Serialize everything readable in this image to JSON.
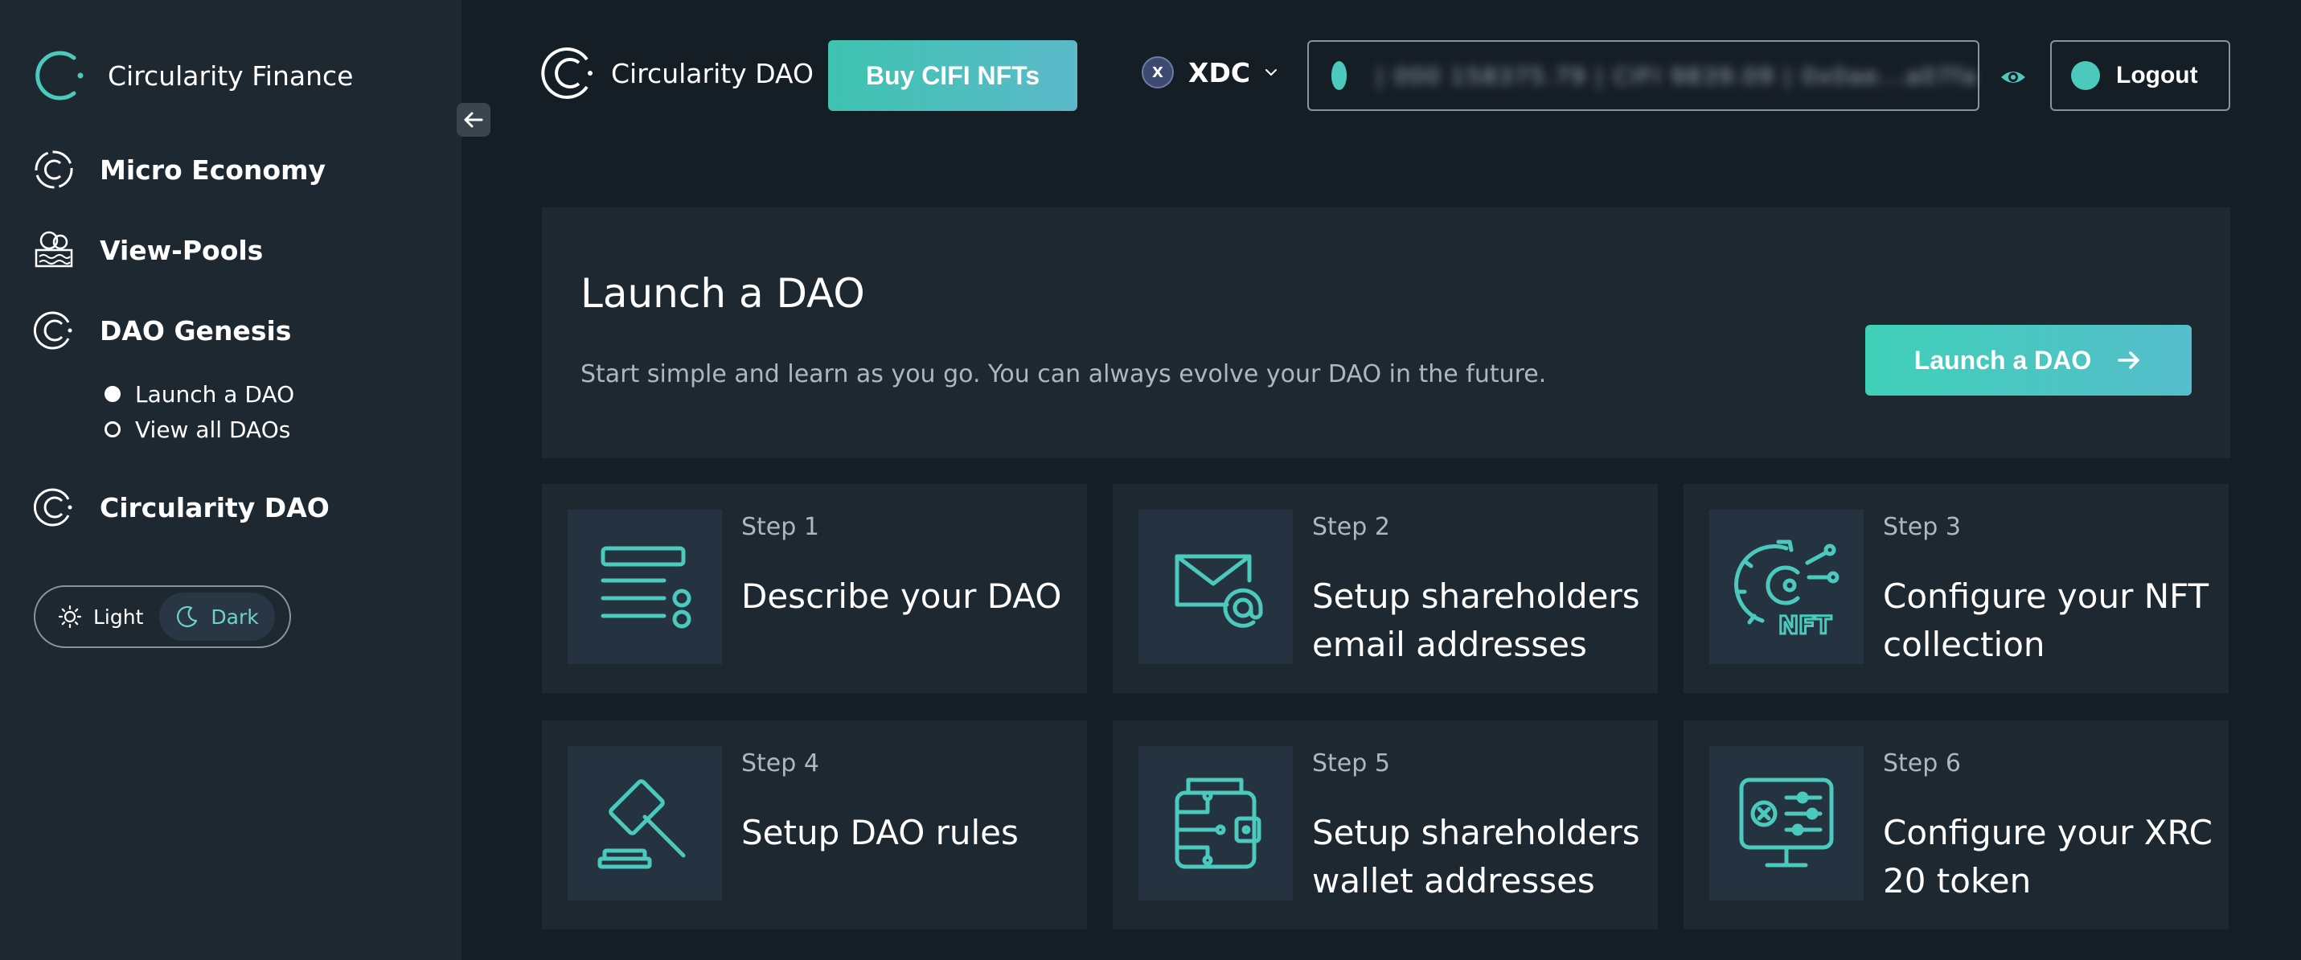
{
  "sidebar": {
    "brand": "Circularity Finance",
    "items": [
      {
        "label": "Micro Economy",
        "icon": "circle-logo-icon"
      },
      {
        "label": "View-Pools",
        "icon": "coins-pool-icon"
      },
      {
        "label": "DAO Genesis",
        "icon": "circle-logo-icon"
      },
      {
        "label": "Circularity DAO",
        "icon": "circle-logo-icon"
      }
    ],
    "subitems": [
      {
        "label": "Launch a DAO",
        "selected": true
      },
      {
        "label": "View all DAOs",
        "selected": false
      }
    ],
    "theme": {
      "light": "Light",
      "dark": "Dark",
      "active": "dark"
    }
  },
  "header": {
    "brand": "Circularity DAO",
    "buy_label": "Buy CIFI NFTs",
    "network": "XDC",
    "network_badge": "X",
    "wallet_text": "| 000 158375.79 | CIFI 9839.09 | 0x0ae...a07fa",
    "logout_label": "Logout"
  },
  "hero": {
    "title": "Launch a DAO",
    "subtitle": "Start simple and learn as you go. You can always evolve your DAO in the future.",
    "button_label": "Launch a DAO"
  },
  "steps": [
    {
      "num": "Step 1",
      "title": "Describe your DAO",
      "icon": "list-icon"
    },
    {
      "num": "Step 2",
      "title": "Setup shareholders email addresses",
      "icon": "envelope-icon"
    },
    {
      "num": "Step 3",
      "title": "Configure your NFT collection",
      "icon": "nft-gear-icon"
    },
    {
      "num": "Step 4",
      "title": "Setup DAO rules",
      "icon": "gavel-icon"
    },
    {
      "num": "Step 5",
      "title": "Setup shareholders wallet addresses",
      "icon": "wallet-icon"
    },
    {
      "num": "Step 6",
      "title": "Configure your XRC 20 token",
      "icon": "monitor-settings-icon"
    }
  ],
  "colors": {
    "accent": "#4cc9bd",
    "background": "#151d25",
    "panel": "#1e2831"
  }
}
